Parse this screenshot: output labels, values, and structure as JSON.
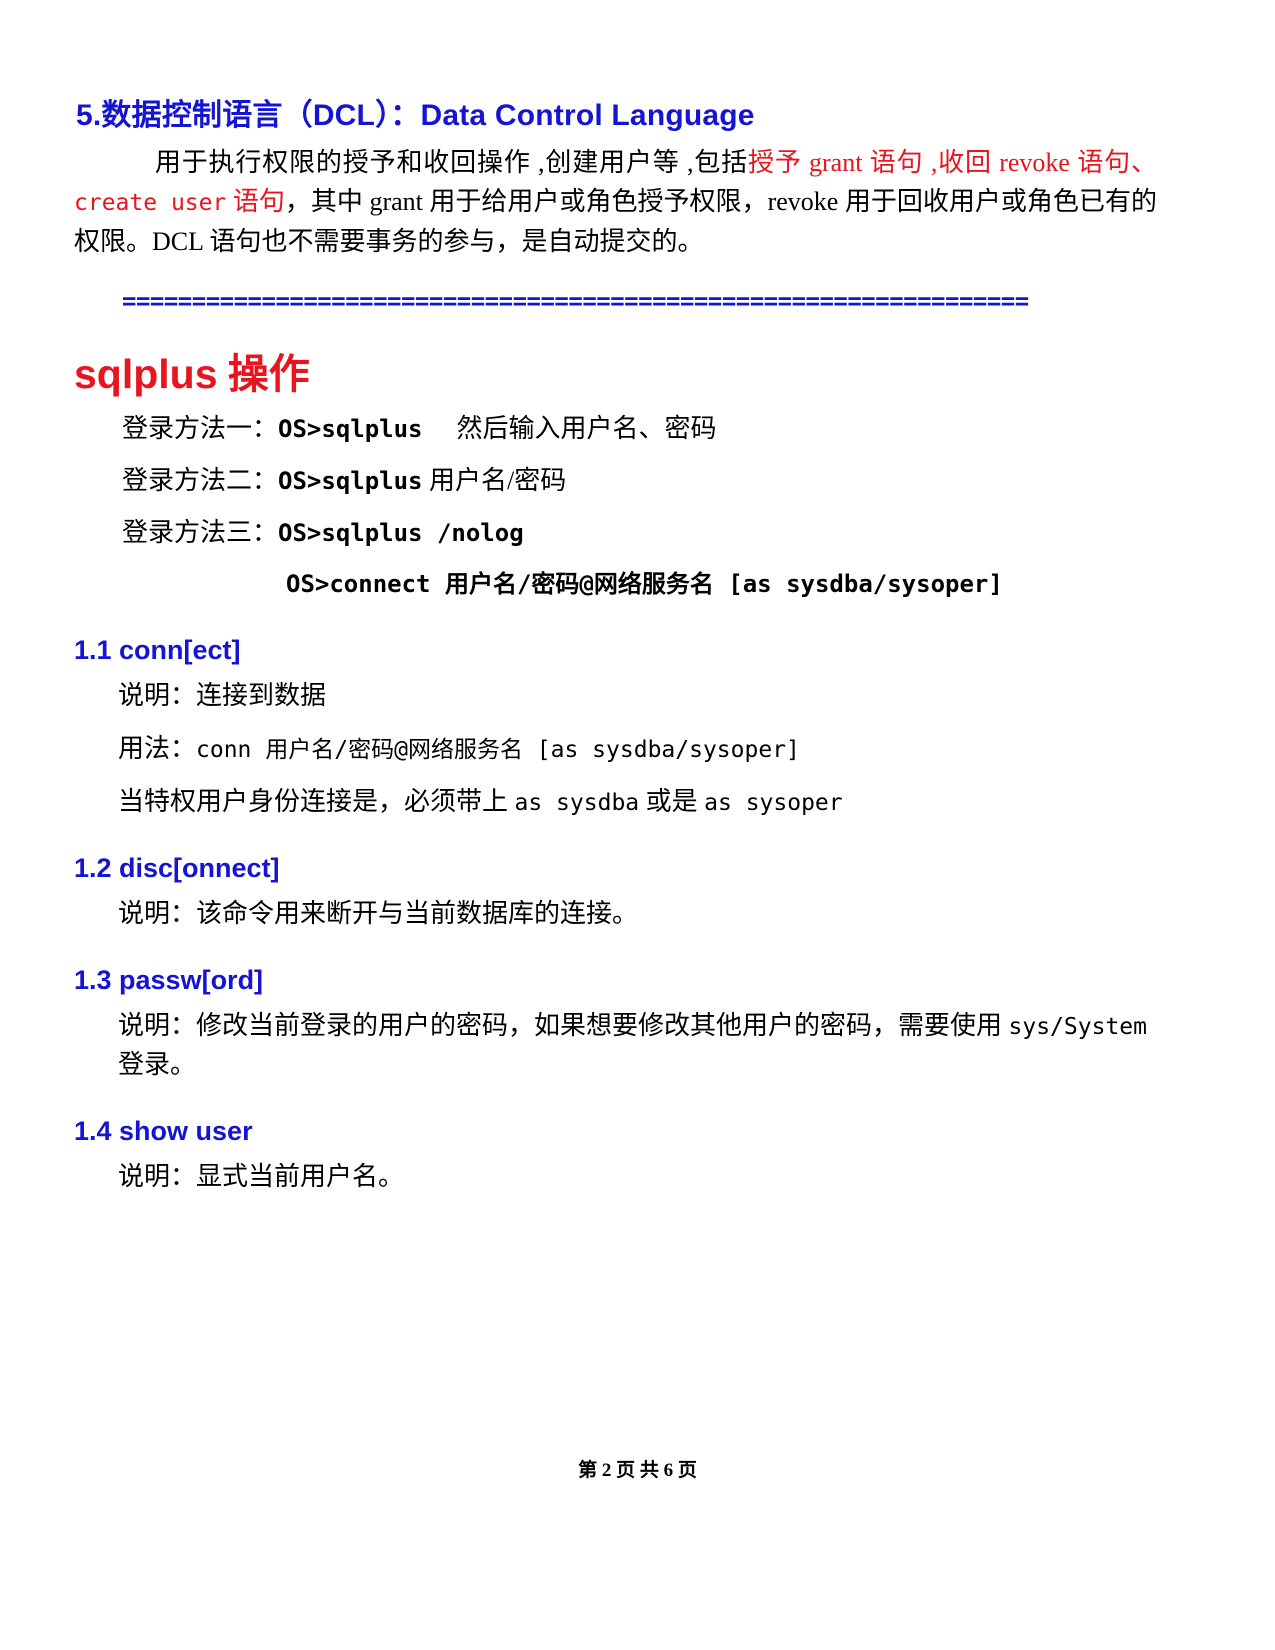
{
  "document": {
    "heading_dcl": "5.数据控制语言（DCL）：Data Control Language",
    "intro": {
      "part1": "用于执行权限的授予和收回操作 ,创建用户等 ,包括",
      "red1": "授予 grant 语句 ,收回 revoke 语句、",
      "red_mono": "create user",
      "red2": " 语句",
      "part2": "，其中 grant 用于给用户或角色授予权限，revoke 用于回收用户或角色已有的权限。DCL 语句也不需要事务的参与，是自动提交的。"
    },
    "separator": "=================================================================",
    "heading_sqlplus_latin": "sqlplus",
    "heading_sqlplus_han": " 操作",
    "login_methods": [
      {
        "label": "登录方法一：",
        "command": "OS>sqlplus",
        "note": "然后输入用户名、密码"
      },
      {
        "label": "登录方法二：",
        "command": "OS>sqlplus",
        "note": "用户名/密码"
      },
      {
        "label": "登录方法三：",
        "command": "OS>sqlplus /nolog",
        "note": ""
      }
    ],
    "connect_line": "OS>connect 用户名/密码@网络服务名 [as sysdba/sysoper]",
    "sections": [
      {
        "heading": "1.1 conn[ect]",
        "lines": [
          {
            "text": "说明：连接到数据"
          },
          {
            "prefix": "用法：",
            "code": "conn 用户名/密码@网络服务名 [as sysdba/sysoper]"
          },
          {
            "prefix": "当特权用户身份连接是，必须带上 ",
            "code": "as sysdba",
            "mid": " 或是 ",
            "code2": "as sysoper"
          }
        ]
      },
      {
        "heading": "1.2 disc[onnect]",
        "lines": [
          {
            "text": "说明：该命令用来断开与当前数据库的连接。"
          }
        ]
      },
      {
        "heading": "1.3 passw[ord]",
        "lines": [
          {
            "prefix": "说明：修改当前登录的用户的密码，如果想要修改其他用户的密码，需要使用 ",
            "code": "sys/System",
            "mid": " 登录。"
          }
        ]
      },
      {
        "heading": "1.4 show user",
        "lines": [
          {
            "text": "说明：显式当前用户名。"
          }
        ]
      }
    ],
    "footer": "第 2 页 共 6 页"
  },
  "colors": {
    "heading_blue": "#1414d2",
    "heading_red": "#e8141e",
    "text_black": "#000000",
    "page_background": "#ffffff"
  }
}
